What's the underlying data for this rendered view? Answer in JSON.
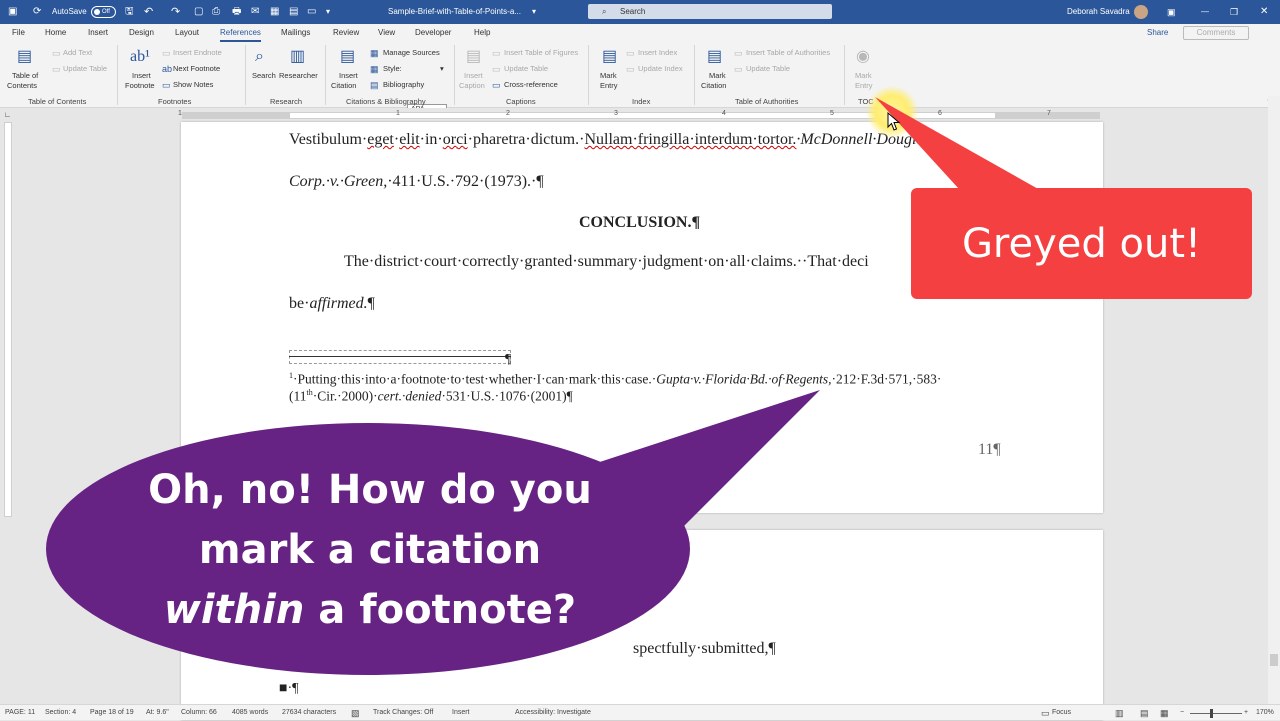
{
  "titlebar": {
    "autosave_label": "AutoSave",
    "autosave_state": "Off",
    "doc_title": "Sample-Brief-with-Table-of-Points-a...",
    "search_placeholder": "Search",
    "user_name": "Deborah Savadra"
  },
  "menu": {
    "tabs": [
      "File",
      "Home",
      "Insert",
      "Design",
      "Layout",
      "References",
      "Mailings",
      "Review",
      "View",
      "Developer",
      "Help"
    ],
    "active_tab": "References",
    "share_label": "Share",
    "comments_label": "Comments"
  },
  "ribbon": {
    "toc": {
      "label1": "Table of",
      "label2": "Contents",
      "add_text": "Add Text",
      "update_table": "Update Table",
      "group": "Table of Contents"
    },
    "footnotes": {
      "insert1": "Insert",
      "insert2": "Footnote",
      "insert_endnote": "Insert Endnote",
      "next_footnote": "Next Footnote",
      "show_notes": "Show Notes",
      "group": "Footnotes"
    },
    "research": {
      "search": "Search",
      "researcher": "Researcher",
      "group": "Research"
    },
    "citations": {
      "insert1": "Insert",
      "insert2": "Citation",
      "manage_sources": "Manage Sources",
      "style_label": "Style:",
      "style_value": "APA",
      "bibliography": "Bibliography",
      "group": "Citations & Bibliography"
    },
    "captions": {
      "insert1": "Insert",
      "insert2": "Caption",
      "insert_tof": "Insert Table of Figures",
      "update_table": "Update Table",
      "cross_reference": "Cross-reference",
      "group": "Captions"
    },
    "index": {
      "mark1": "Mark",
      "mark2": "Entry",
      "insert_index": "Insert Index",
      "update_index": "Update Index",
      "group": "Index"
    },
    "toa": {
      "mark1": "Mark",
      "mark2": "Citation",
      "insert_toa": "Insert Table of Authorities",
      "update_table": "Update Table",
      "group": "Table of Authorities"
    },
    "toc_entry": {
      "mark1": "Mark",
      "mark2": "Entry",
      "group": "TOC"
    }
  },
  "ruler": {
    "numbers": [
      "1",
      "1",
      "2",
      "3",
      "4",
      "5",
      "6",
      "7"
    ]
  },
  "document": {
    "line1": {
      "a": "Vestibulum·",
      "b": "eget",
      "c": "·",
      "d": "elit",
      "e": "·in·",
      "f": "orci",
      "g": "·pharetra·dictum.·",
      "h": "Nullam·fringilla·interdum·tortor.",
      "i": "·McDonnell·Douglas·"
    },
    "line2": {
      "a": "Corp.·v.·Green,",
      "b": "·411·U.S.·792·(1973).·¶"
    },
    "heading": "CONCLUSION.¶",
    "line3": "The·district·court·correctly·granted·summary·judgment·on·all·claims.··That·deci",
    "line4": {
      "a": "be·",
      "b": "affirmed.",
      "c": "¶"
    },
    "fn_para": "¶",
    "footnote": {
      "num": "1",
      "a": "·Putting·this·into·a·footnote·to·test·whether·I·can·mark·this·case.·",
      "b": "Gupta·v.·Florida·Bd.·of·Regents,",
      "c": "·212·F.3d·571,·583·",
      "d": "(11",
      "sup": "th",
      "e": "·Cir.·2000)·",
      "f": "cert.·denied",
      "g": "·531·U.S.·1076·(2001)¶"
    },
    "page_number": "11¶",
    "page2_line": "spectfully·submitted,¶",
    "page2_bullet": "■·¶"
  },
  "callouts": {
    "red": "Greyed out!",
    "purple": {
      "l1": "Oh, no! How do you",
      "l2": "mark a citation",
      "l3a": "within",
      "l3b": " a footnote?"
    }
  },
  "status": {
    "page": "PAGE: 11",
    "section": "Section: 4",
    "page_of": "Page 18 of 19",
    "at": "At: 9.6\"",
    "column": "Column: 66",
    "words": "4085 words",
    "chars": "27634 characters",
    "track": "Track Changes: Off",
    "insert": "Insert",
    "accessibility": "Accessibility: Investigate",
    "focus": "Focus",
    "zoom": "170%"
  },
  "colors": {
    "brand": "#2b579a",
    "callout_red": "#f44040",
    "callout_purple": "#662383"
  }
}
